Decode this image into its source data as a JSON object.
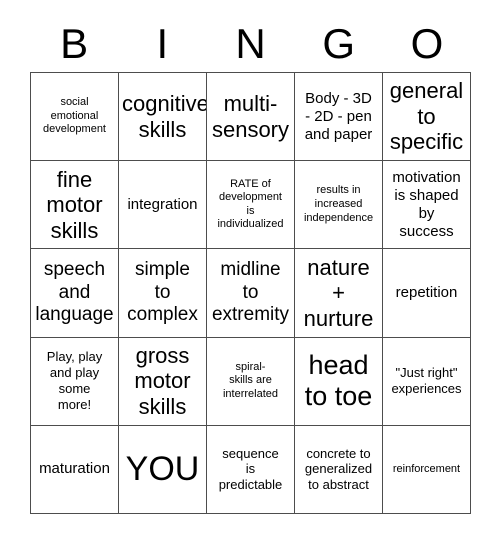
{
  "header": {
    "letters": [
      "B",
      "I",
      "N",
      "G",
      "O"
    ]
  },
  "grid": {
    "rows": 5,
    "columns": 5,
    "border_color": "#4d4d4d",
    "background_color": "#ffffff",
    "text_color": "#000000",
    "free_space_label": "YOU",
    "free_space_position": {
      "row": 5,
      "column": 2
    }
  },
  "cells": [
    {
      "row": 1,
      "column": 1,
      "text": "social\nemotional\ndevelopment",
      "size": "xs"
    },
    {
      "row": 1,
      "column": 2,
      "text": "cognitive\nskills",
      "size": "xl"
    },
    {
      "row": 1,
      "column": 3,
      "text": "multi-\nsensory",
      "size": "xl"
    },
    {
      "row": 1,
      "column": 4,
      "text": "Body - 3D\n- 2D - pen\nand paper",
      "size": "m"
    },
    {
      "row": 1,
      "column": 5,
      "text": "general\nto\nspecific",
      "size": "xl"
    },
    {
      "row": 2,
      "column": 1,
      "text": "fine\nmotor\nskills",
      "size": "xl"
    },
    {
      "row": 2,
      "column": 2,
      "text": "integration",
      "size": "m"
    },
    {
      "row": 2,
      "column": 3,
      "text": "RATE of\ndevelopment\nis\nindividualized",
      "size": "xs"
    },
    {
      "row": 2,
      "column": 4,
      "text": "results in\nincreased\nindependence",
      "size": "xs"
    },
    {
      "row": 2,
      "column": 5,
      "text": "motivation\nis shaped\nby\nsuccess",
      "size": "m"
    },
    {
      "row": 3,
      "column": 1,
      "text": "speech\nand\nlanguage",
      "size": "l"
    },
    {
      "row": 3,
      "column": 2,
      "text": "simple\nto\ncomplex",
      "size": "l"
    },
    {
      "row": 3,
      "column": 3,
      "text": "midline\nto\nextremity",
      "size": "l"
    },
    {
      "row": 3,
      "column": 4,
      "text": "nature\n+\nnurture",
      "size": "xl"
    },
    {
      "row": 3,
      "column": 5,
      "text": "repetition",
      "size": "m"
    },
    {
      "row": 4,
      "column": 1,
      "text": "Play, play\nand play\nsome\nmore!",
      "size": "s"
    },
    {
      "row": 4,
      "column": 2,
      "text": "gross\nmotor\nskills",
      "size": "xl"
    },
    {
      "row": 4,
      "column": 3,
      "text": "spiral-\nskills are\ninterrelated",
      "size": "xs"
    },
    {
      "row": 4,
      "column": 4,
      "text": "head\nto toe",
      "size": "2xl"
    },
    {
      "row": 4,
      "column": 5,
      "text": "\"Just right\"\nexperiences",
      "size": "s"
    },
    {
      "row": 5,
      "column": 1,
      "text": "maturation",
      "size": "m"
    },
    {
      "row": 5,
      "column": 2,
      "text": "YOU",
      "size": "3xl"
    },
    {
      "row": 5,
      "column": 3,
      "text": "sequence\nis\npredictable",
      "size": "s"
    },
    {
      "row": 5,
      "column": 4,
      "text": "concrete to\ngeneralized\nto abstract",
      "size": "s"
    },
    {
      "row": 5,
      "column": 5,
      "text": "reinforcement",
      "size": "xs"
    }
  ]
}
